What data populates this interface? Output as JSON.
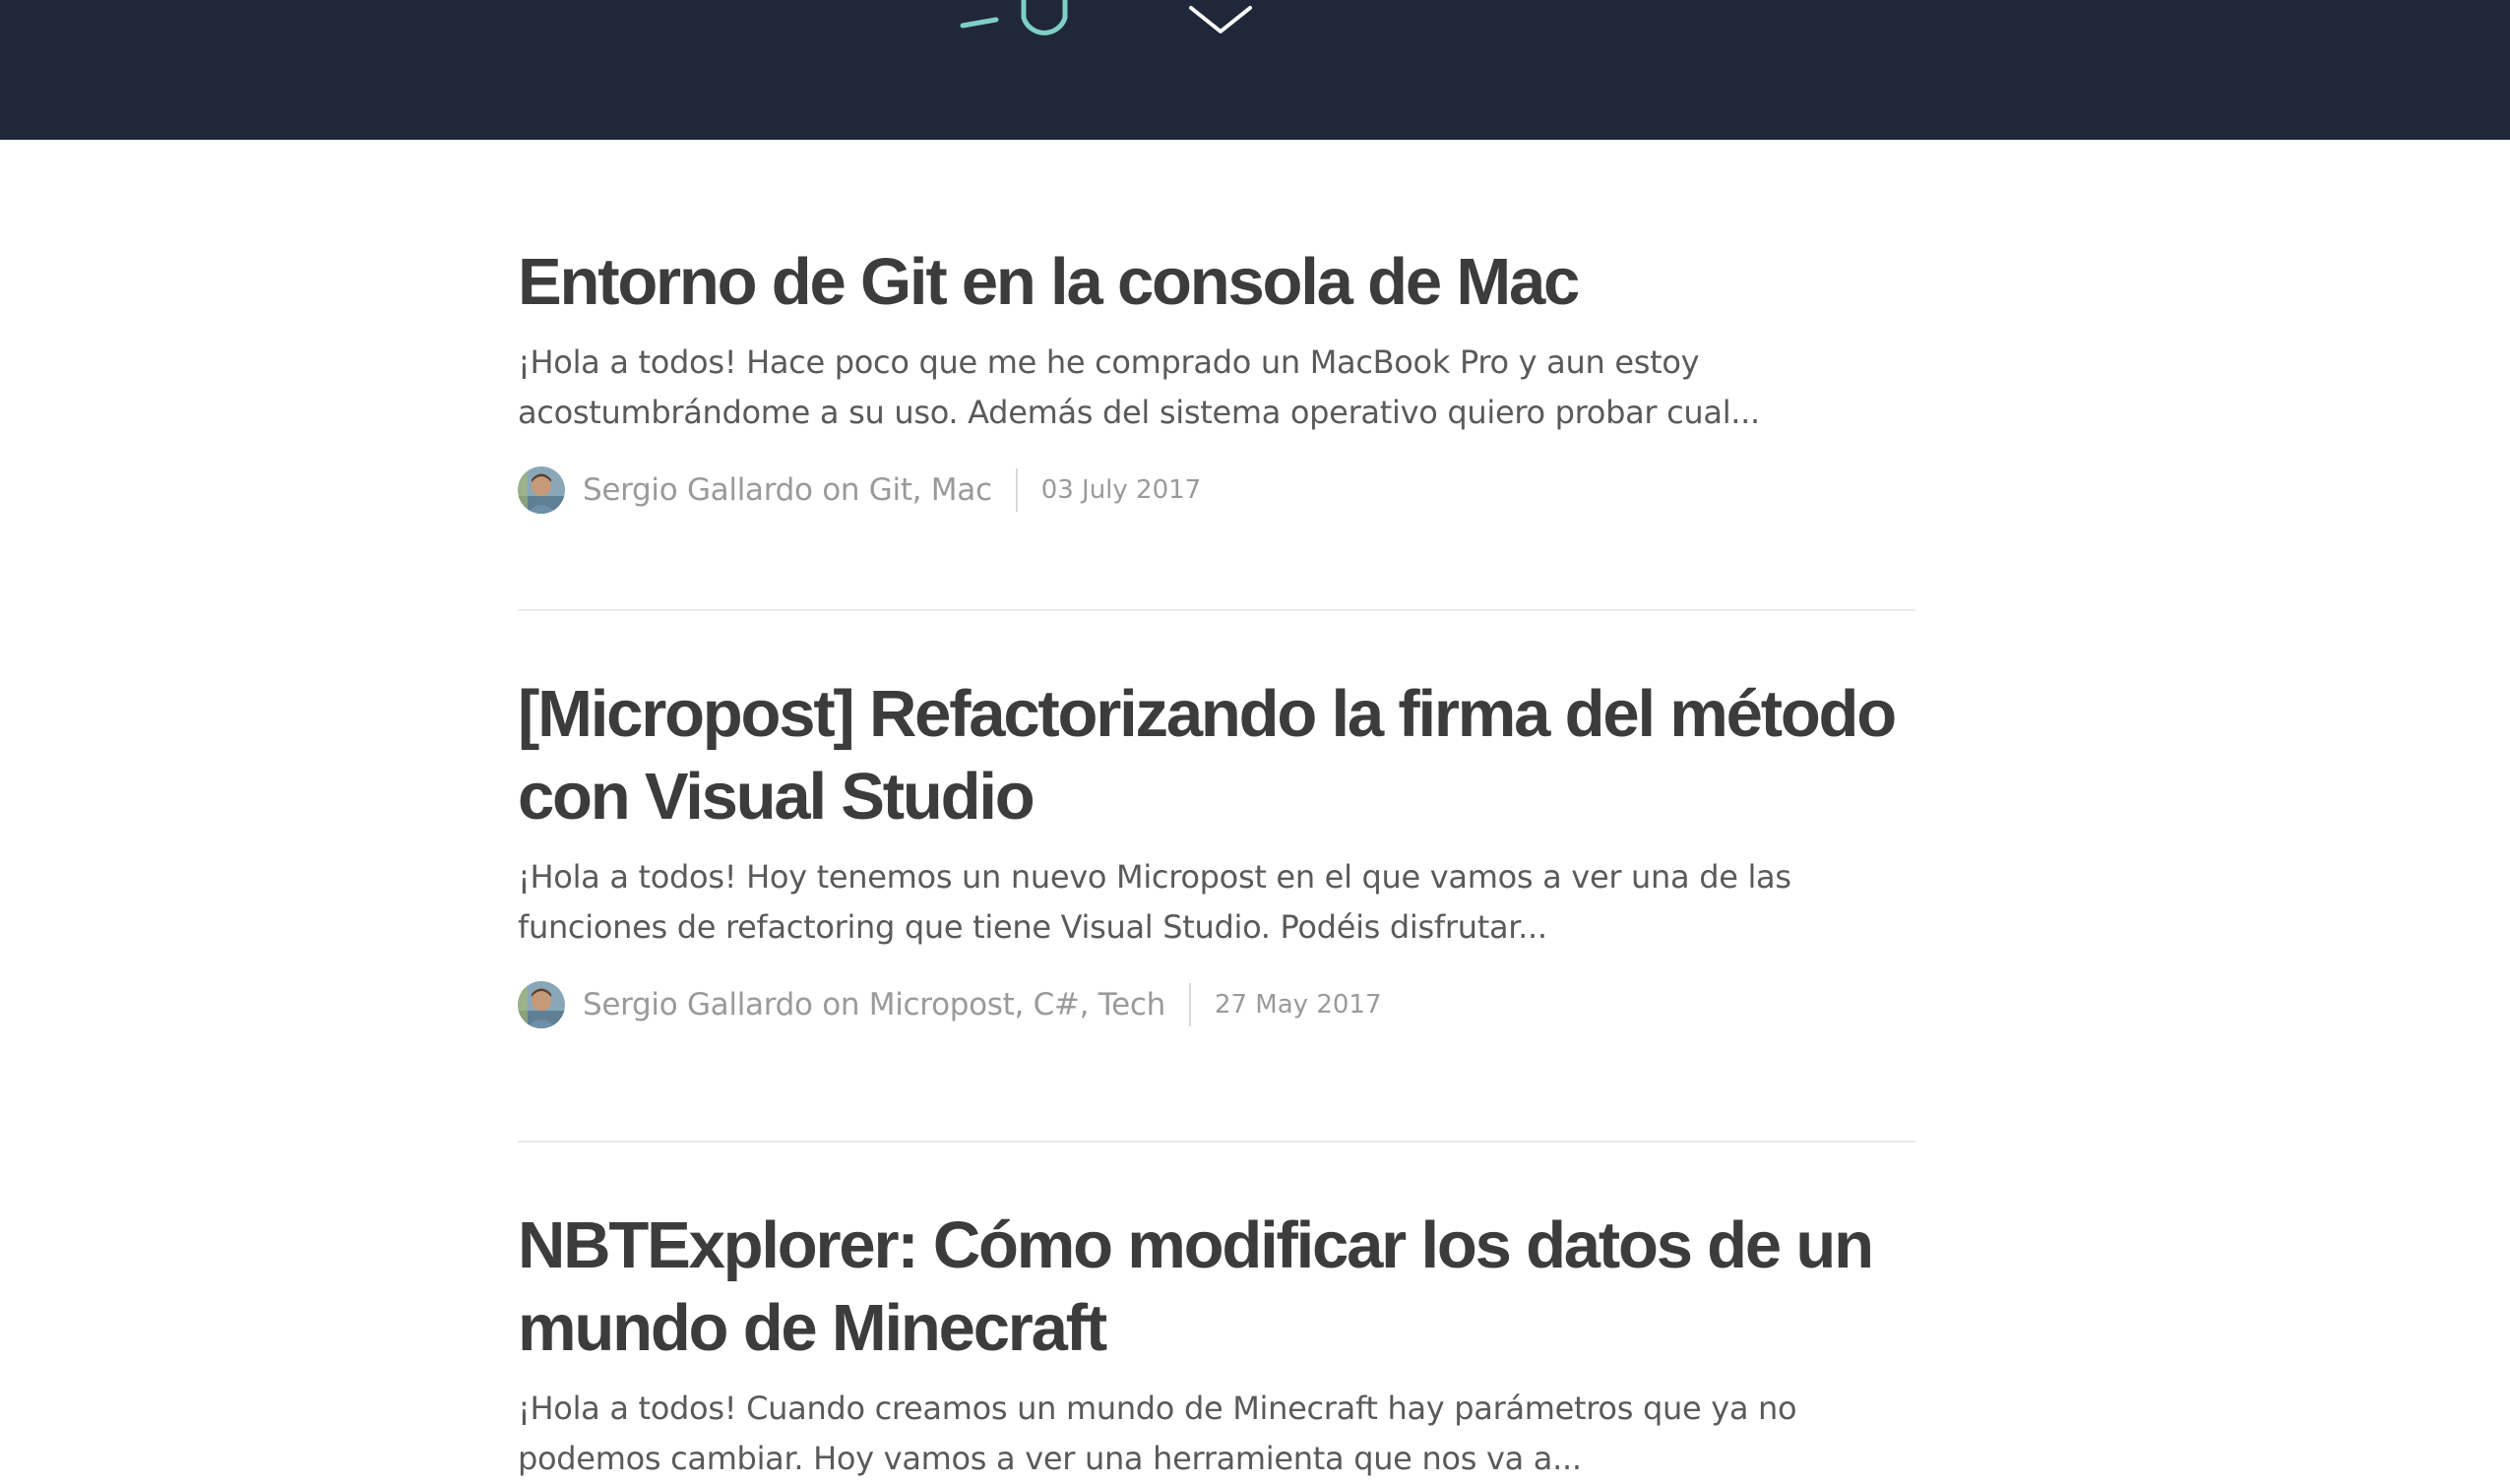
{
  "theme": {
    "hero_background": "#1f2739",
    "logo_accent": "#7fd0c4",
    "title_color": "#3c3c3c",
    "text_color": "#5a5a5a",
    "meta_color": "#9a9a9a"
  },
  "hero": {
    "logo_icon": "site-logo",
    "scroll_icon": "chevron-down-icon"
  },
  "posts": [
    {
      "title": "Entorno de Git en la consola de Mac",
      "excerpt": "¡Hola a todos! Hace poco que me he comprado un MacBook Pro y aun estoy acostumbrándome a su uso. Además del sistema operativo quiero probar cual...",
      "author": "Sergio Gallardo",
      "on": "on",
      "tags": "Git, Mac",
      "date": "03 July 2017"
    },
    {
      "title": "[Micropost] Refactorizando la firma del método con Visual Studio",
      "excerpt": "¡Hola a todos! Hoy tenemos un nuevo Micropost en el que vamos a ver una de las funciones de refactoring que tiene Visual Studio. Podéis disfrutar...",
      "author": "Sergio Gallardo",
      "on": "on",
      "tags": "Micropost, C#, Tech",
      "date": "27 May 2017"
    },
    {
      "title": "NBTExplorer: Cómo modificar los datos de un mundo de Minecraft",
      "excerpt": "¡Hola a todos! Cuando creamos un mundo de Minecraft hay parámetros que ya no podemos cambiar. Hoy vamos a ver una herramienta que nos va a..."
    }
  ]
}
